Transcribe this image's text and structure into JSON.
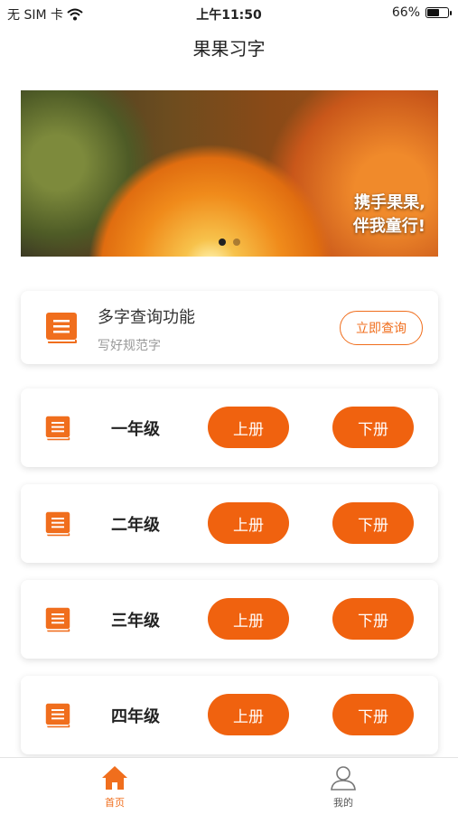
{
  "status_bar": {
    "carrier": "无 SIM 卡",
    "time": "上午11:50",
    "battery": "66%",
    "battery_level": 0.66
  },
  "nav": {
    "title": "果果习字"
  },
  "banner": {
    "slogan_line1": "携手果果,",
    "slogan_line2": "伴我童行!",
    "active_page": 1,
    "page_count": 2
  },
  "search_card": {
    "title": "多字查询功能",
    "subtitle": "写好规范字",
    "button": "立即查询"
  },
  "grades": [
    {
      "label": "一年级",
      "upper": "上册",
      "lower": "下册"
    },
    {
      "label": "二年级",
      "upper": "上册",
      "lower": "下册"
    },
    {
      "label": "三年级",
      "upper": "上册",
      "lower": "下册"
    },
    {
      "label": "四年级",
      "upper": "上册",
      "lower": "下册"
    }
  ],
  "tabs": [
    {
      "label": "首页",
      "icon": "home-icon",
      "active": true
    },
    {
      "label": "我的",
      "icon": "user-icon",
      "active": false
    }
  ],
  "colors": {
    "accent": "#f0620f",
    "accent_outline": "#f06e1d"
  }
}
